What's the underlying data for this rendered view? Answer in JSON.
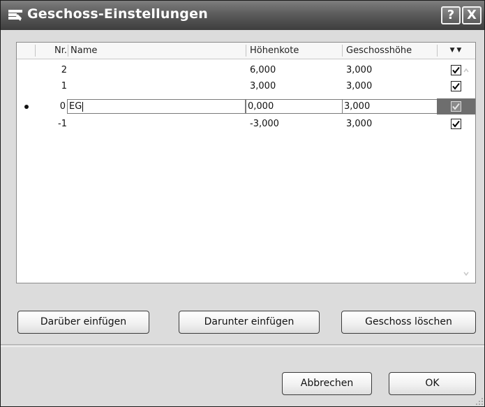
{
  "window": {
    "title": "Geschoss-Einstellungen",
    "help_label": "?",
    "close_label": "X"
  },
  "table": {
    "headers": {
      "nr": "Nr.",
      "name": "Name",
      "elevation": "Höhenkote",
      "story_height": "Geschosshöhe",
      "show": "▼ ▼"
    },
    "rows": [
      {
        "nr": "2",
        "name": "",
        "elevation": "6,000",
        "height": "3,000",
        "checked": true
      },
      {
        "nr": "1",
        "name": "",
        "elevation": "3,000",
        "height": "3,000",
        "checked": true
      },
      {
        "nr": "0",
        "name": "EG",
        "elevation": "0,000",
        "height": "3,000",
        "checked": true,
        "selected": true
      },
      {
        "nr": "-1",
        "name": "",
        "elevation": "-3,000",
        "height": "3,000",
        "checked": true
      }
    ]
  },
  "buttons": {
    "insert_above": "Darüber einfügen",
    "insert_below": "Darunter einfügen",
    "delete_story": "Geschoss löschen",
    "cancel": "Abbrechen",
    "ok": "OK"
  }
}
